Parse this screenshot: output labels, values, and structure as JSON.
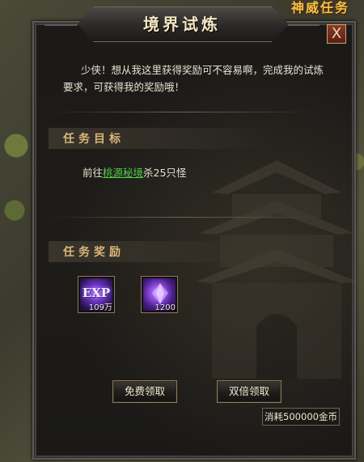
{
  "world": {
    "label": "神威任务"
  },
  "dialog": {
    "title": "境界试炼",
    "close_label": "X",
    "intro_line1": "少侠！想从我这里获得奖励可不容易啊，完成我的试炼",
    "intro_line2": "要求，可获得我的奖励哦！",
    "objective": {
      "heading": "任务目标",
      "prefix": "前往",
      "location_link": "桃源秘境",
      "suffix": "杀25只怪"
    },
    "rewards": {
      "heading": "任务奖励",
      "items": [
        {
          "icon": "exp-icon",
          "icon_text": "EXP",
          "quantity": "109万"
        },
        {
          "icon": "purple-gem-icon",
          "quantity": "1200"
        }
      ]
    },
    "free_claim_label": "免费领取",
    "double_claim_label": "双倍领取",
    "double_cost_label": "消耗500000金币"
  }
}
